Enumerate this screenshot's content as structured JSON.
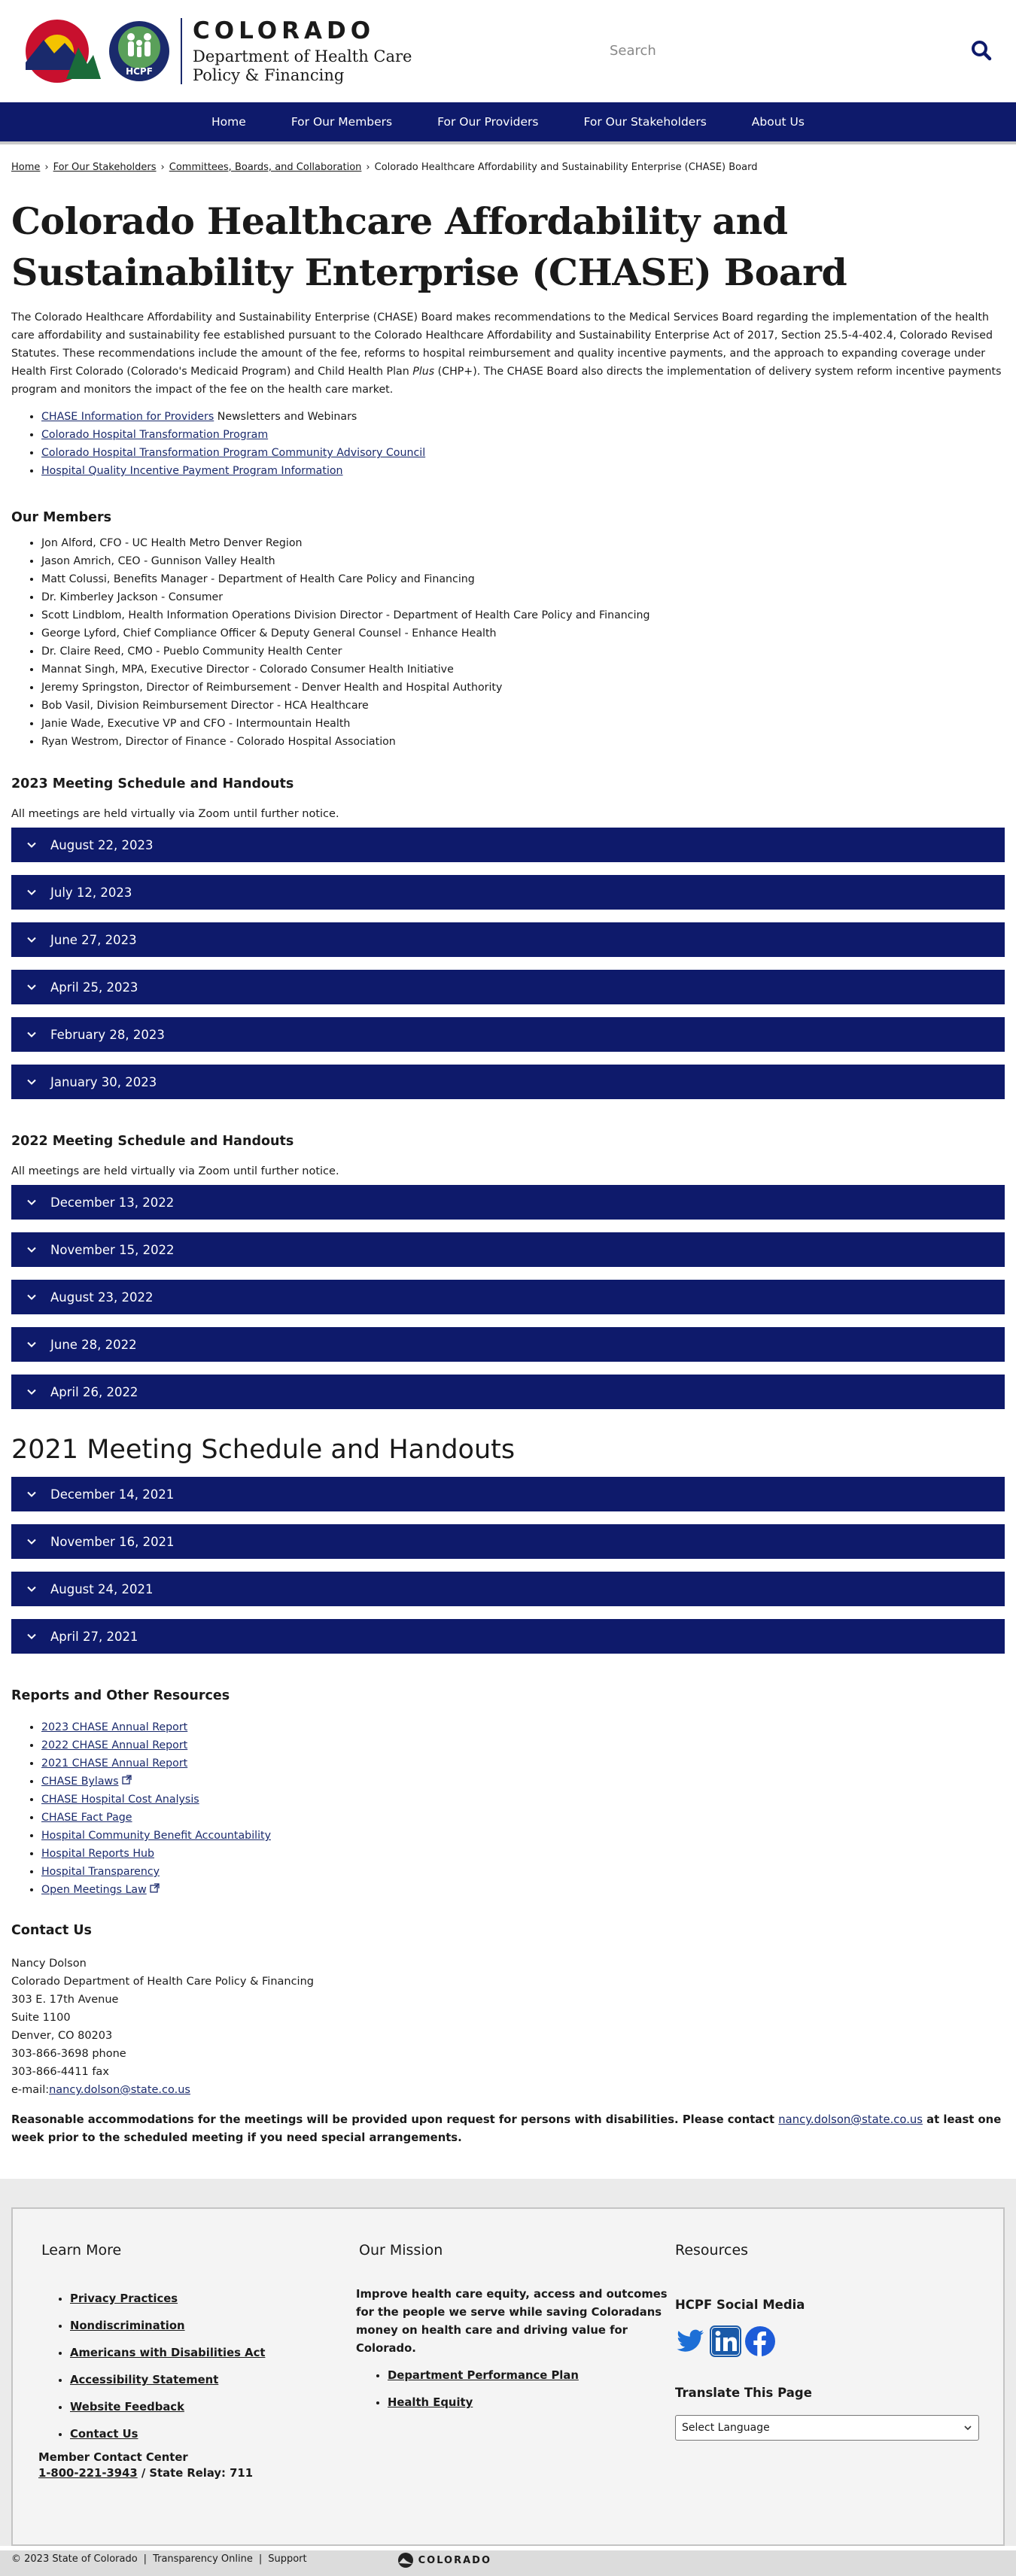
{
  "header": {
    "colorado_word": "COLORADO",
    "dept_line1": "Department of Health Care",
    "dept_line2": "Policy & Financing",
    "hcpf_badge": "HCPF",
    "search_placeholder": "Search",
    "icons": [
      "colorado-logo",
      "hcpf-logo",
      "search-icon"
    ]
  },
  "nav": [
    "Home",
    "For Our Members",
    "For Our Providers",
    "For Our Stakeholders",
    "About Us"
  ],
  "breadcrumb": {
    "items": [
      "Home",
      "For Our Stakeholders",
      "Committees, Boards, and Collaboration"
    ],
    "current": "Colorado Healthcare Affordability and Sustainability Enterprise (CHASE) Board",
    "separator": "›"
  },
  "page_title": "Colorado Healthcare Affordability and Sustainability Enterprise (CHASE) Board",
  "intro": {
    "before_plus": "The Colorado Healthcare Affordability and Sustainability Enterprise (CHASE) Board makes recommendations to the Medical Services Board regarding the implementation of the health care affordability and sustainability fee established pursuant to the Colorado Healthcare Affordability and Sustainability Enterprise Act of 2017, Section 25.5-4-402.4, Colorado Revised Statutes. These recommendations include the amount of the fee, reforms to hospital reimbursement and quality incentive payments, and the approach to expanding coverage under Health First Colorado (Colorado's Medicaid Program) and Child Health Plan",
    "plus": "Plus",
    "after_plus": "(CHP+). The CHASE Board also directs the implementation of delivery system reform incentive payments program and monitors the impact of the fee on the health care market."
  },
  "top_links": {
    "first_link": "CHASE Information for Providers",
    "first_suffix": "Newsletters and Webinars",
    "others": [
      "Colorado Hospital Transformation Program",
      "Colorado Hospital Transformation Program Community Advisory Council",
      "Hospital Quality Incentive Payment Program Information"
    ]
  },
  "members": {
    "heading": "Our Members",
    "list": [
      "Jon Alford, CFO - UC Health Metro Denver Region",
      "Jason Amrich, CEO - Gunnison Valley Health",
      "Matt Colussi, Benefits Manager - Department of Health Care Policy and Financing",
      "Dr. Kimberley Jackson - Consumer",
      "Scott Lindblom, Health Information Operations Division Director - Department of Health Care Policy and Financing",
      "George Lyford, Chief Compliance Officer & Deputy General Counsel - Enhance Health",
      "Dr. Claire Reed, CMO - Pueblo Community Health Center",
      "Mannat Singh, MPA, Executive Director - Colorado Consumer Health Initiative",
      "Jeremy Springston, Director of Reimbursement - Denver Health and Hospital Authority",
      "Bob Vasil, Division Reimbursement Director - HCA Healthcare",
      "Janie Wade, Executive VP and CFO - Intermountain Health",
      "Ryan Westrom, Director of Finance - Colorado Hospital Association"
    ]
  },
  "schedule_2023": {
    "heading": "2023 Meeting Schedule and Handouts",
    "note": "All meetings are held virtually via Zoom until further notice.",
    "items": [
      "August 22, 2023",
      "July 12, 2023",
      "June 27, 2023",
      "April 25, 2023",
      "February 28, 2023",
      "January 30, 2023"
    ]
  },
  "schedule_2022": {
    "heading": "2022 Meeting Schedule and Handouts",
    "note": "All meetings are held virtually via Zoom until further notice.",
    "items": [
      "December 13, 2022",
      "November 15, 2022",
      "August 23, 2022",
      "June 28, 2022",
      "April 26, 2022"
    ]
  },
  "schedule_2021": {
    "heading": "2021 Meeting Schedule and Handouts",
    "items": [
      "December 14, 2021",
      "November 16, 2021",
      "August 24, 2021",
      "April 27, 2021"
    ]
  },
  "reports": {
    "heading": "Reports and Other Resources",
    "items": [
      {
        "label": "2023 CHASE Annual Report",
        "external": false
      },
      {
        "label": "2022 CHASE Annual Report",
        "external": false
      },
      {
        "label": "2021 CHASE Annual Report",
        "external": false
      },
      {
        "label": "CHASE Bylaws",
        "external": true
      },
      {
        "label": "CHASE Hospital Cost Analysis",
        "external": false
      },
      {
        "label": "CHASE Fact Page",
        "external": false
      },
      {
        "label": "Hospital Community Benefit Accountability",
        "external": false
      },
      {
        "label": "Hospital Reports Hub",
        "external": false
      },
      {
        "label": "Hospital Transparency",
        "external": false
      },
      {
        "label": "Open Meetings Law",
        "external": true
      }
    ]
  },
  "contact": {
    "heading": "Contact Us",
    "lines": [
      "Nancy Dolson",
      "Colorado Department of Health Care Policy & Financing",
      "303 E. 17th Avenue",
      "Suite 1100",
      "Denver, CO 80203",
      "303-866-3698 phone",
      "303-866-4411 fax"
    ],
    "email_prefix": "e-mail:",
    "email": "nancy.dolson@state.co.us"
  },
  "accommodation": {
    "before": "Reasonable accommodations for the meetings will be provided upon request for persons with disabilities. Please contact",
    "email": "nancy.dolson@state.co.us",
    "after": "at least one week prior to the scheduled meeting if you need special arrangements."
  },
  "footer": {
    "learn_more": {
      "heading": "Learn More",
      "links": [
        "Privacy Practices",
        "Nondiscrimination",
        "Americans with Disabilities Act",
        "Accessibility Statement",
        "Website Feedback",
        "Contact Us"
      ],
      "member_center": "Member Contact Center",
      "phone": "1-800-221-3943",
      "relay": "/ State Relay: 711"
    },
    "mission": {
      "heading": "Our Mission",
      "text": "Improve health care equity, access and outcomes for the people we serve while saving Coloradans money on health care and driving value for Colorado.",
      "links": [
        "Department Performance Plan",
        "Health Equity"
      ]
    },
    "resources": {
      "heading": "Resources",
      "social_heading": "HCPF Social Media",
      "social_icons": [
        "twitter-icon",
        "linkedin-icon",
        "facebook-icon"
      ],
      "translate_heading": "Translate This Page",
      "select_value": "Select Language"
    }
  },
  "bottom_bar": {
    "items": [
      "© 2023 State of Colorado",
      "Transparency Online",
      "Support"
    ],
    "separator": "|",
    "logo_text": "COLORADO"
  },
  "colors": {
    "navy": "#0e1a6b",
    "link": "#1a2a6c",
    "footer_bg": "#ebebeb"
  }
}
